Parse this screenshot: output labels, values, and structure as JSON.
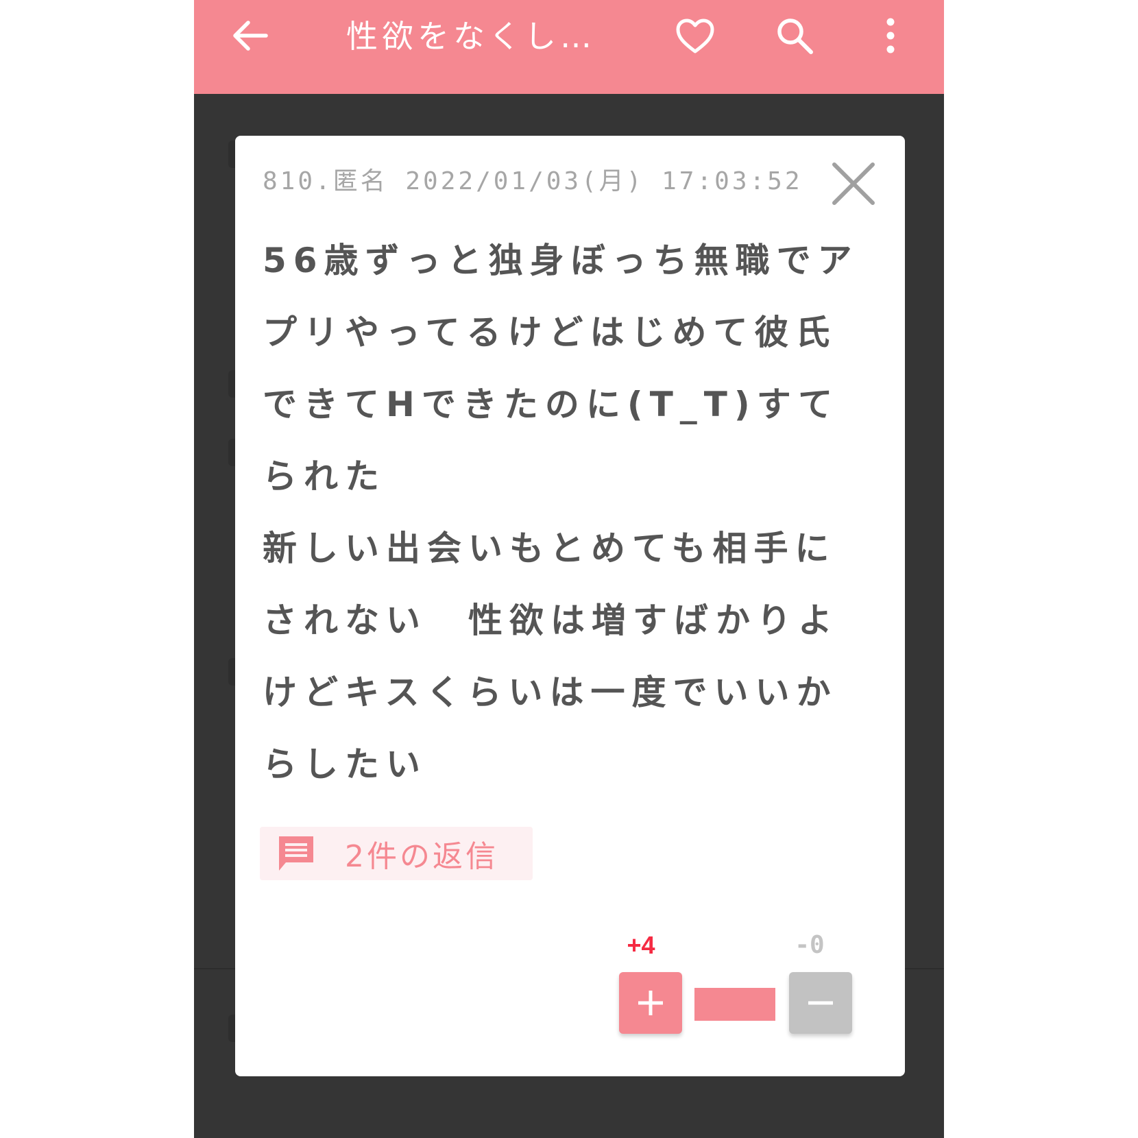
{
  "appbar": {
    "title": "性欲をなくし…",
    "icons": [
      "back-arrow-icon",
      "heart-icon",
      "search-icon",
      "more-vert-icon"
    ],
    "color": "#f58891"
  },
  "post": {
    "meta": "810.匿名 2022/01/03(月) 17:03:52",
    "body": "56歳ずっと独身ぼっち無職でアプリやってるけどはじめて彼氏できてHできたのに(T_T)すてられた\n新しい出会いもとめても相手にされない　性欲は増すばかりよけどキスくらいは一度でいいからしたい",
    "reply_label": "2件の返信",
    "plus_count": "+4",
    "minus_count": "-0",
    "plus_ratio": 1.0
  },
  "colors": {
    "accent": "#f58891",
    "plus_count": "#f52b43",
    "overlay": "#353535"
  }
}
